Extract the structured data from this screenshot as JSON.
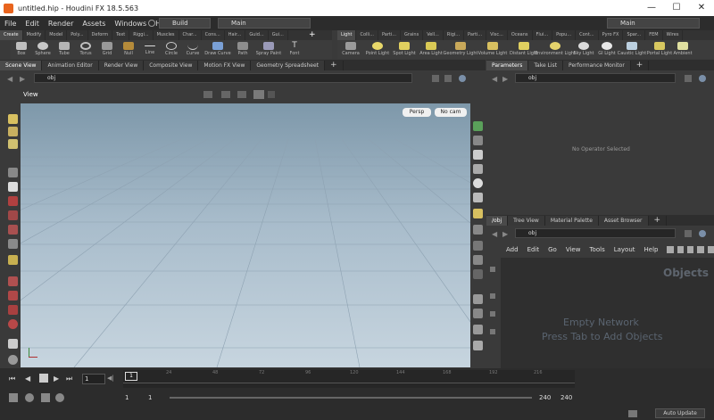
{
  "window": {
    "title": "untitled.hip - Houdini FX 18.5.563"
  },
  "menu": [
    "File",
    "Edit",
    "Render",
    "Assets",
    "Windows",
    "Help"
  ],
  "desktop": {
    "build": "Build",
    "main": "Main",
    "main_right": "Main"
  },
  "shelf_tabs_left": [
    "Create",
    "Modify",
    "Model",
    "Poly...",
    "Deform",
    "Text",
    "Riggi...",
    "Muscles",
    "Char...",
    "Cons...",
    "Hair...",
    "Guid...",
    "Gui..."
  ],
  "shelf_tabs_right": [
    "Light",
    "Colli...",
    "Parti...",
    "Grains",
    "Vell...",
    "Rigi...",
    "Parti...",
    "Visc...",
    "Oceans",
    "Flui...",
    "Popu...",
    "Cont...",
    "Pyro FX",
    "Spar...",
    "FEM",
    "Wires"
  ],
  "tools_left": [
    "Box",
    "Sphere",
    "Tube",
    "Torus",
    "Grid",
    "Null",
    "Line",
    "Circle",
    "Curve",
    "Draw Curve",
    "Path",
    "Spray Paint",
    "Font"
  ],
  "tools_right": [
    "Camera",
    "Point Light",
    "Spot Light",
    "Area Light",
    "Geometry Light",
    "Volume Light",
    "Distant Light",
    "Environment Light",
    "Sky Light",
    "GI Light",
    "Caustic Light",
    "Portal Light",
    "Ambient"
  ],
  "pane_tabs_left": [
    "Scene View",
    "Animation Editor",
    "Render View",
    "Composite View",
    "Motion FX View",
    "Geometry Spreadsheet"
  ],
  "pane_tabs_right_top": [
    "Parameters",
    "Take List",
    "Performance Monitor"
  ],
  "pane_tabs_right_bottom": [
    "/obj",
    "Tree View",
    "Material Palette",
    "Asset Browser"
  ],
  "viewer": {
    "path": "obj",
    "label": "View",
    "persp": "Persp",
    "cam": "No cam"
  },
  "params": {
    "path": "obj",
    "empty": "No Operator Selected"
  },
  "network": {
    "path": "obj",
    "menu": [
      "Add",
      "Edit",
      "Go",
      "View",
      "Tools",
      "Layout",
      "Help"
    ],
    "heading": "Objects",
    "empty1": "Empty Network",
    "empty2": "Press Tab to Add Objects"
  },
  "timeline": {
    "ticks": [
      "24",
      "48",
      "72",
      "96",
      "120",
      "144",
      "168",
      "192",
      "216"
    ],
    "frame": "1",
    "start": "1",
    "start2": "1",
    "end": "240",
    "end2": "240",
    "auto_update": "Auto Update",
    "marker": "1"
  }
}
